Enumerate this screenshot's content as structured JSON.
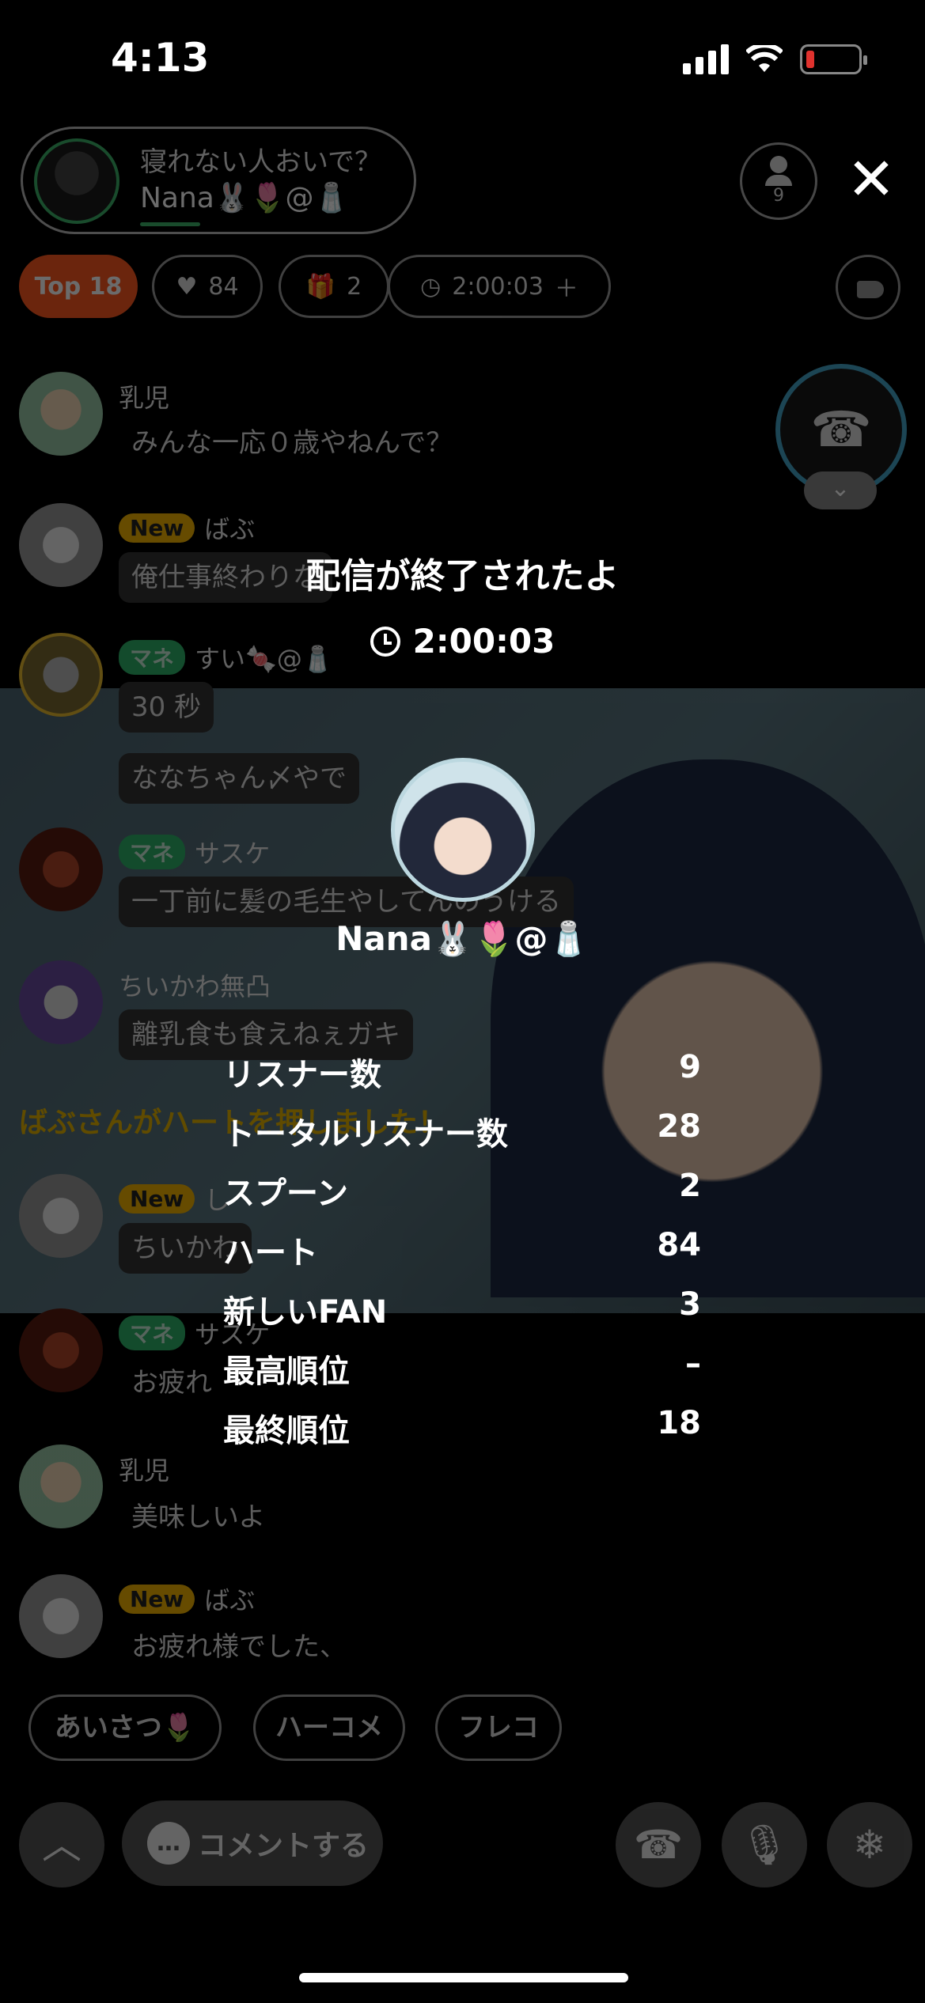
{
  "status_bar": {
    "time": "4:13"
  },
  "host": {
    "subtitle": "寝れない人おいで？",
    "name": "Nana🐰🌷@🧂",
    "listener_count": "9"
  },
  "chips": {
    "rank": "Top 18",
    "hearts": "84",
    "gifts": "2",
    "elapsed": "2:00:03"
  },
  "chat": [
    {
      "name": "乳児",
      "text": "みんな一応０歳やねんで？"
    },
    {
      "badge": "New",
      "name": "ばぶ",
      "text": "俺仕事終わりな"
    },
    {
      "badge": "マネ",
      "name": "すい🍬@🧂",
      "text": "30 秒"
    },
    {
      "text": "ななちゃん〆やで"
    },
    {
      "badge": "マネ",
      "name": "サスケ",
      "text": "一丁前に髪の毛生やしてんのうける"
    },
    {
      "name": "ちいかわ無凸",
      "text": "離乳食も食えねぇガキ"
    },
    {
      "badge": "New",
      "name": "し",
      "text": "ちいかわ"
    },
    {
      "badge": "マネ",
      "name": "サスケ",
      "text": "お疲れ"
    },
    {
      "name": "乳児",
      "text": "美味しいよ"
    },
    {
      "badge": "New",
      "name": "ばぶ",
      "text": "お疲れ様でした、"
    }
  ],
  "system_message": "ばぶさんがハートを押しました！",
  "quick_replies": [
    "あいさつ🌷",
    "ハーコメ",
    "フレコ"
  ],
  "comment_button": "コメントする",
  "result": {
    "title": "配信が終了されたよ",
    "duration": "2:00:03",
    "host_name": "Nana🐰🌷@🧂",
    "stats": [
      {
        "label": "リスナー数",
        "value": "9"
      },
      {
        "label": "トータルリスナー数",
        "value": "28"
      },
      {
        "label": "スプーン",
        "value": "2"
      },
      {
        "label": "ハート",
        "value": "84"
      },
      {
        "label": "新しいFAN",
        "value": "3"
      },
      {
        "label": "最高順位",
        "value": "–"
      },
      {
        "label": "最終順位",
        "value": "18"
      }
    ]
  },
  "colors": {
    "accent": "#ff5a1f",
    "green": "#3cb36a",
    "call_ring": "#43a5c9",
    "new_badge": "#f2b400",
    "mane_badge": "#2fb36a",
    "battery_low": "#e0322e"
  }
}
